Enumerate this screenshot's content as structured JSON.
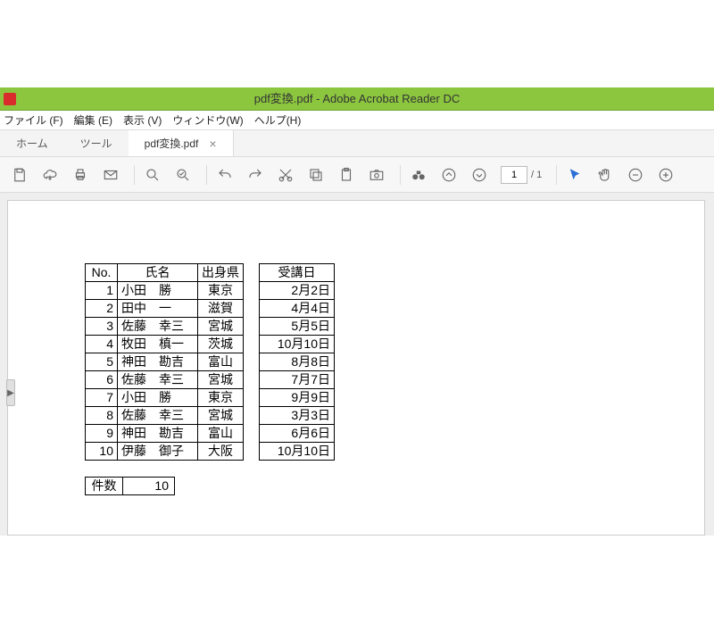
{
  "window": {
    "title": "pdf変換.pdf - Adobe Acrobat Reader DC"
  },
  "menu": {
    "file": "ファイル (F)",
    "edit": "編集 (E)",
    "view": "表示 (V)",
    "window": "ウィンドウ(W)",
    "help": "ヘルプ(H)"
  },
  "tabs": {
    "home": "ホーム",
    "tools": "ツール",
    "doc": "pdf変換.pdf",
    "close": "×"
  },
  "toolbar": {
    "page_current": "1",
    "page_total": "/ 1"
  },
  "table": {
    "headers": {
      "no": "No.",
      "name": "氏名",
      "pref": "出身県",
      "date": "受講日"
    },
    "rows": [
      {
        "no": "1",
        "name": "小田　勝",
        "pref": "東京",
        "date": "2月2日"
      },
      {
        "no": "2",
        "name": "田中　一",
        "pref": "滋賀",
        "date": "4月4日"
      },
      {
        "no": "3",
        "name": "佐藤　幸三",
        "pref": "宮城",
        "date": "5月5日"
      },
      {
        "no": "4",
        "name": "牧田　槙一",
        "pref": "茨城",
        "date": "10月10日"
      },
      {
        "no": "5",
        "name": "神田　勘吉",
        "pref": "富山",
        "date": "8月8日"
      },
      {
        "no": "6",
        "name": "佐藤　幸三",
        "pref": "宮城",
        "date": "7月7日"
      },
      {
        "no": "7",
        "name": "小田　勝",
        "pref": "東京",
        "date": "9月9日"
      },
      {
        "no": "8",
        "name": "佐藤　幸三",
        "pref": "宮城",
        "date": "3月3日"
      },
      {
        "no": "9",
        "name": "神田　勘吉",
        "pref": "富山",
        "date": "6月6日"
      },
      {
        "no": "10",
        "name": "伊藤　御子",
        "pref": "大阪",
        "date": "10月10日"
      }
    ]
  },
  "count": {
    "label": "件数",
    "value": "10"
  }
}
